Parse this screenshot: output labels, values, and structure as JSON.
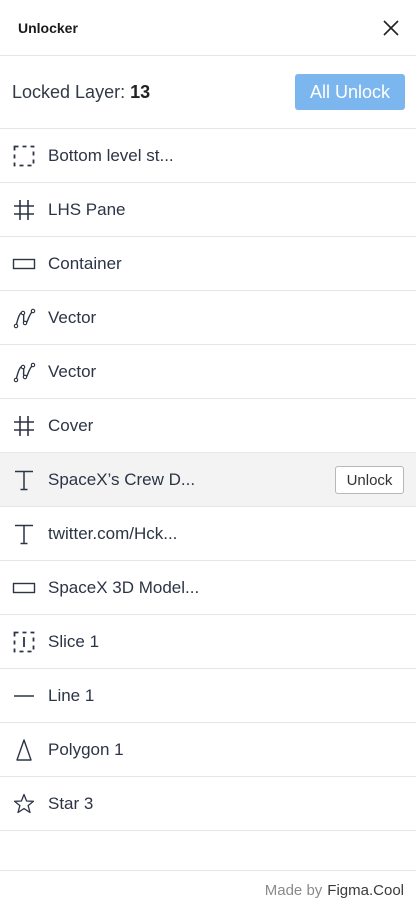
{
  "header": {
    "title": "Unlocker"
  },
  "summary": {
    "label": "Locked Layer:",
    "count": "13",
    "all_unlock_label": "All Unlock"
  },
  "layers": [
    {
      "name": "Bottom level st...",
      "icon": "dashed-frame-icon"
    },
    {
      "name": "LHS Pane",
      "icon": "frame-hash-icon"
    },
    {
      "name": "Container",
      "icon": "rectangle-icon"
    },
    {
      "name": "Vector",
      "icon": "vector-pen-icon"
    },
    {
      "name": "Vector",
      "icon": "vector-pen-icon"
    },
    {
      "name": "Cover",
      "icon": "frame-hash-icon"
    },
    {
      "name": "SpaceX’s Crew D...",
      "icon": "text-icon",
      "selected": true,
      "unlock_label": "Unlock"
    },
    {
      "name": "twitter.com/Hck...",
      "icon": "text-icon"
    },
    {
      "name": "SpaceX 3D Model...",
      "icon": "rectangle-icon"
    },
    {
      "name": "Slice 1",
      "icon": "slice-icon"
    },
    {
      "name": "Line 1",
      "icon": "line-icon"
    },
    {
      "name": "Polygon 1",
      "icon": "polygon-icon"
    },
    {
      "name": "Star 3",
      "icon": "star-icon"
    }
  ],
  "footer": {
    "made_by": "Made by",
    "brand": "Figma.Cool"
  },
  "colors": {
    "accent": "#7cb6ee",
    "selected_row": "#f3f3f3",
    "divider": "#e6e6e6"
  }
}
